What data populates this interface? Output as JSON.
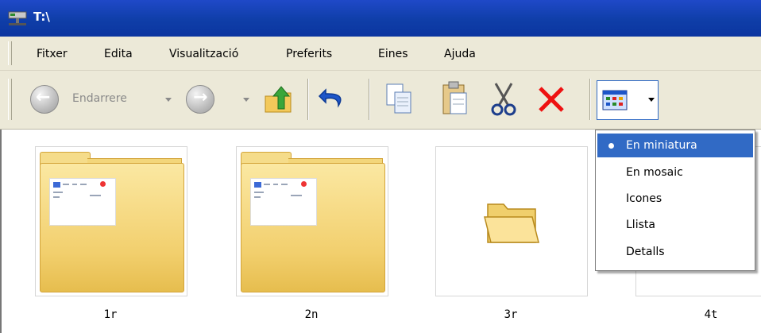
{
  "window": {
    "title": "T:\\"
  },
  "menu": [
    "Fitxer",
    "Edita",
    "Visualització",
    "Preferits",
    "Eines",
    "Ajuda"
  ],
  "toolbar": {
    "back_label": "Endarrere",
    "icons": [
      "back-icon",
      "forward-icon",
      "up-folder-icon",
      "undo-icon",
      "copy-icon",
      "paste-icon",
      "cut-icon",
      "delete-icon",
      "views-icon"
    ]
  },
  "items": [
    {
      "name": "1r",
      "type": "folder-with-preview"
    },
    {
      "name": "2n",
      "type": "folder-with-preview"
    },
    {
      "name": "3r",
      "type": "folder"
    },
    {
      "name": "4t",
      "type": "folder"
    }
  ],
  "views_menu": {
    "options": [
      "En miniatura",
      "En mosaic",
      "Icones",
      "Llista",
      "Detalls"
    ],
    "selected": "En miniatura"
  },
  "colors": {
    "titlebar": "#0f3ea8",
    "chrome": "#ece9d8",
    "selection": "#316ac5",
    "delete": "#e11",
    "folder": "#f2cf6d"
  }
}
